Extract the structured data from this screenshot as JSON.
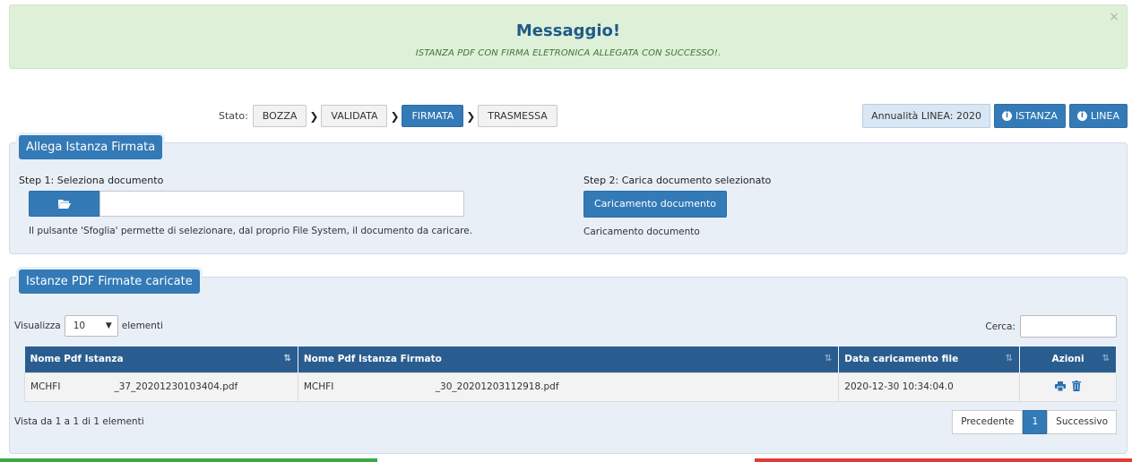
{
  "alert": {
    "title": "Messaggio!",
    "message": "ISTANZA PDF CON FIRMA ELETRONICA ALLEGATA CON SUCCESSO!.",
    "close": "×"
  },
  "stato": {
    "label": "Stato:",
    "steps": [
      "BOZZA",
      "VALIDATA",
      "FIRMATA",
      "TRASMESSA"
    ],
    "active_step": "FIRMATA"
  },
  "header_buttons": {
    "annualita": "Annualità LINEA: 2020",
    "istanza": "ISTANZA",
    "linea": "LINEA"
  },
  "allega": {
    "legend": "Allega Istanza Firmata",
    "step1": "Step 1: Seleziona documento",
    "hint": "Il pulsante 'Sfoglia' permette di selezionare, dal proprio File System, il documento da caricare.",
    "step2": "Step 2: Carica documento selezionato",
    "carica_button": "Caricamento documento",
    "carica_text": "Caricamento documento"
  },
  "istanze": {
    "legend": "Istanze PDF Firmate caricate",
    "visualizza": "Visualizza",
    "page_size": "10",
    "elementi": "elementi",
    "cerca": "Cerca:",
    "columns": [
      "Nome Pdf Istanza",
      "Nome Pdf Istanza Firmato",
      "Data caricamento file",
      "Azioni"
    ],
    "rows": [
      {
        "nome": "MCHFI                  _37_20201230103404.pdf",
        "firmato": "MCHFI                                  _30_20201203112918.pdf",
        "data": "2020-12-30 10:34:04.0"
      }
    ],
    "vista": "Vista da 1 a 1 di 1 elementi",
    "pager": {
      "prev": "Precedente",
      "current": "1",
      "next": "Successivo"
    }
  },
  "colors": {
    "primary": "#337ab7",
    "table_header": "#2a5d8f",
    "alert_bg": "#dff0d8",
    "panel_bg": "#e9eff7",
    "flag": [
      "#3aa845",
      "#ffffff",
      "#e03a3a"
    ]
  }
}
